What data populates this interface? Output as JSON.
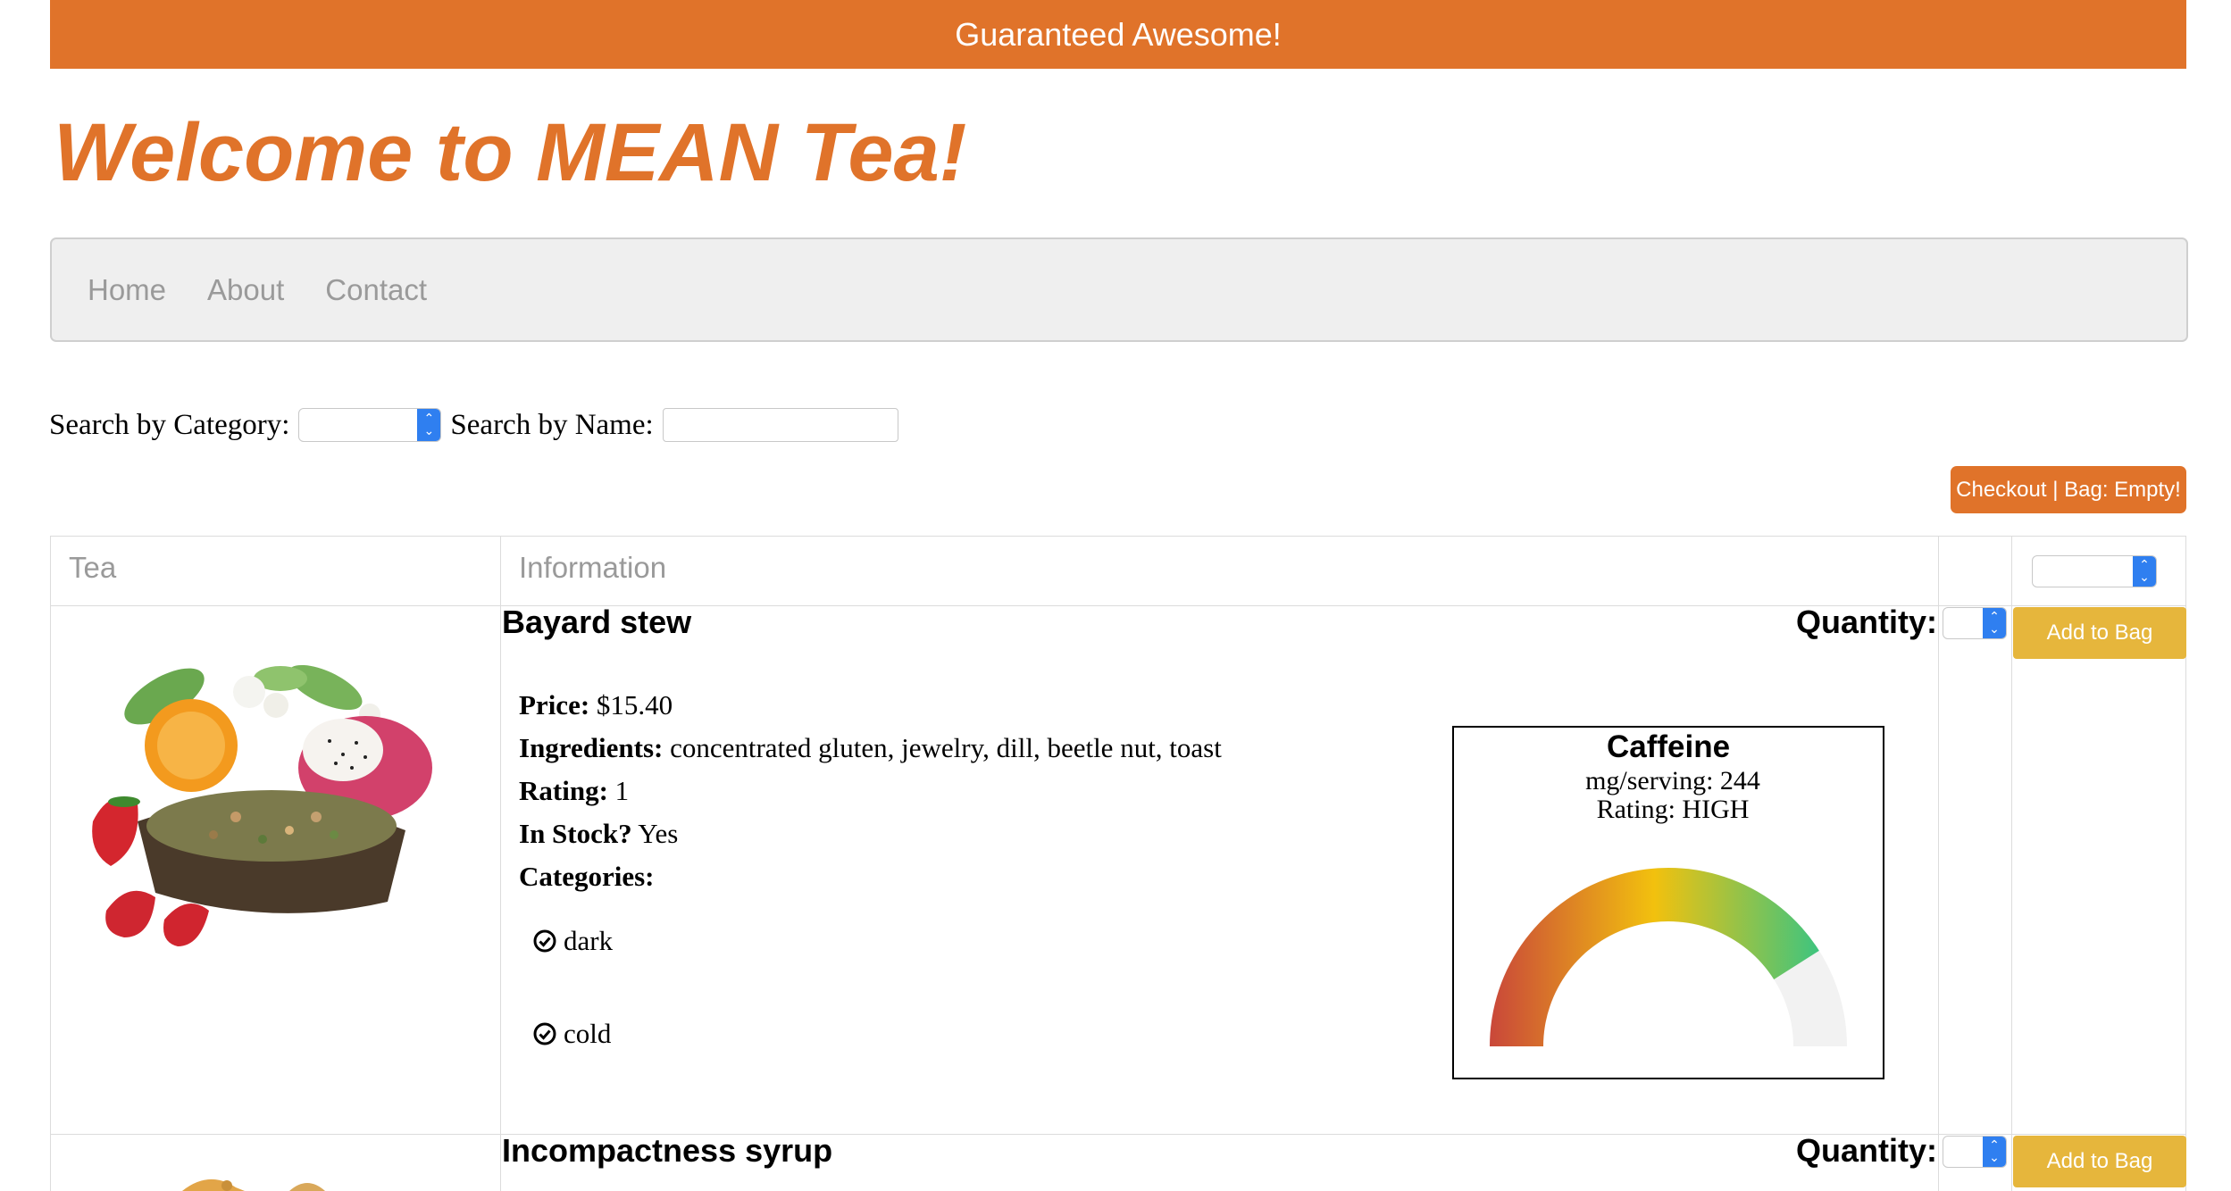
{
  "banner": {
    "text": "Guaranteed Awesome!"
  },
  "header": {
    "title": "Welcome to MEAN Tea!"
  },
  "nav": {
    "items": [
      "Home",
      "About",
      "Contact"
    ]
  },
  "search": {
    "category_label": "Search by Category:",
    "category_value": "",
    "name_label": "Search by Name:",
    "name_value": ""
  },
  "checkout": {
    "label": "Checkout | Bag: Empty!"
  },
  "table": {
    "headers": {
      "tea": "Tea",
      "information": "Information"
    },
    "sort_value": ""
  },
  "teas": [
    {
      "name": "Bayard stew",
      "quantity_label": "Quantity:",
      "quantity_value": "",
      "add_label": "Add to Bag",
      "price_label": "Price:",
      "price": "$15.40",
      "ingredients_label": "Ingredients:",
      "ingredients": "concentrated gluten, jewelry, dill, beetle nut, toast",
      "rating_label": "Rating:",
      "rating": "1",
      "stock_label": "In Stock?",
      "stock": "Yes",
      "categories_label": "Categories:",
      "categories": [
        "dark",
        "cold"
      ],
      "caffeine": {
        "title": "Caffeine",
        "mg_text": "mg/serving: 244",
        "rating_text": "Rating: HIGH",
        "level": 0.82,
        "colors": [
          "#c9473a",
          "#f2c10e",
          "#3ec47f"
        ]
      }
    },
    {
      "name": "Incompactness syrup",
      "quantity_label": "Quantity:",
      "quantity_value": "",
      "add_label": "Add to Bag"
    }
  ]
}
